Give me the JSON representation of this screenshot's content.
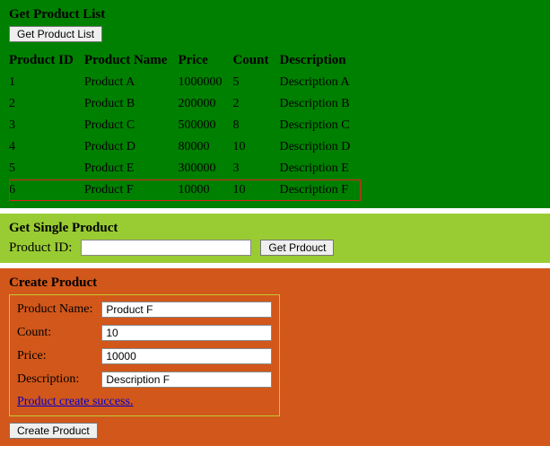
{
  "list": {
    "title": "Get Product List",
    "button": "Get Product List",
    "headers": {
      "id": "Product ID",
      "name": "Product Name",
      "price": "Price",
      "count": "Count",
      "desc": "Description"
    },
    "rows": [
      {
        "id": "1",
        "name": "Product A",
        "price": "1000000",
        "count": "5",
        "desc": "Description A",
        "selected": false
      },
      {
        "id": "2",
        "name": "Product B",
        "price": "200000",
        "count": "2",
        "desc": "Description B",
        "selected": false
      },
      {
        "id": "3",
        "name": "Product C",
        "price": "500000",
        "count": "8",
        "desc": "Description C",
        "selected": false
      },
      {
        "id": "4",
        "name": "Product D",
        "price": "80000",
        "count": "10",
        "desc": "Description D",
        "selected": false
      },
      {
        "id": "5",
        "name": "Product E",
        "price": "300000",
        "count": "3",
        "desc": "Description E",
        "selected": false
      },
      {
        "id": "6",
        "name": "Product F",
        "price": "10000",
        "count": "10",
        "desc": "Description F",
        "selected": true
      }
    ]
  },
  "single": {
    "title": "Get Single Product",
    "label": "Product ID:",
    "value": "",
    "button": "Get Prdouct"
  },
  "create": {
    "title": "Create Product",
    "labels": {
      "name": "Product Name:",
      "count": "Count:",
      "price": "Price:",
      "desc": "Description:"
    },
    "values": {
      "name": "Product F",
      "count": "10",
      "price": "10000",
      "desc": "Description F"
    },
    "message": "Product create success.",
    "button": "Create Product"
  }
}
